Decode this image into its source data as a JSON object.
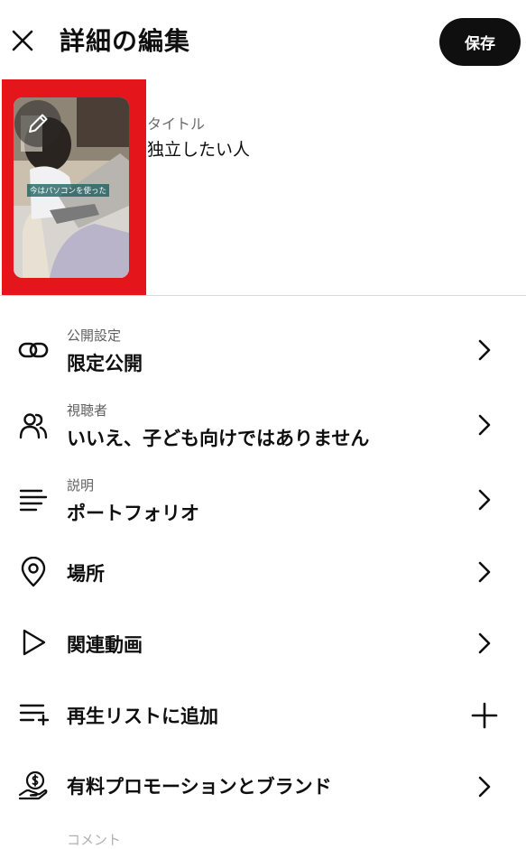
{
  "header": {
    "title": "詳細の編集",
    "save_label": "保存",
    "close_icon": "close-icon"
  },
  "thumbnail": {
    "caption": "今はパソコンを使った",
    "edit_icon": "pencil-icon",
    "highlight_color": "#e5161b"
  },
  "title_field": {
    "label": "タイトル",
    "value": "独立したい人"
  },
  "settings": [
    {
      "icon": "link-icon",
      "sub": "公開設定",
      "main": "限定公開",
      "action": "chevron-right-icon"
    },
    {
      "icon": "people-icon",
      "sub": "視聴者",
      "main": "いいえ、子ども向けではありません",
      "action": "chevron-right-icon"
    },
    {
      "icon": "description-icon",
      "sub": "説明",
      "main": "ポートフォリオ",
      "action": "chevron-right-icon"
    },
    {
      "icon": "location-pin-icon",
      "sub": "",
      "main": "場所",
      "action": "chevron-right-icon"
    },
    {
      "icon": "play-icon",
      "sub": "",
      "main": "関連動画",
      "action": "chevron-right-icon"
    },
    {
      "icon": "playlist-add-icon",
      "sub": "",
      "main": "再生リストに追加",
      "action": "plus-icon"
    },
    {
      "icon": "promotion-dollar-icon",
      "sub": "",
      "main": "有料プロモーションとブランド",
      "action": "chevron-right-icon"
    }
  ],
  "next_item_partial": "コメント"
}
